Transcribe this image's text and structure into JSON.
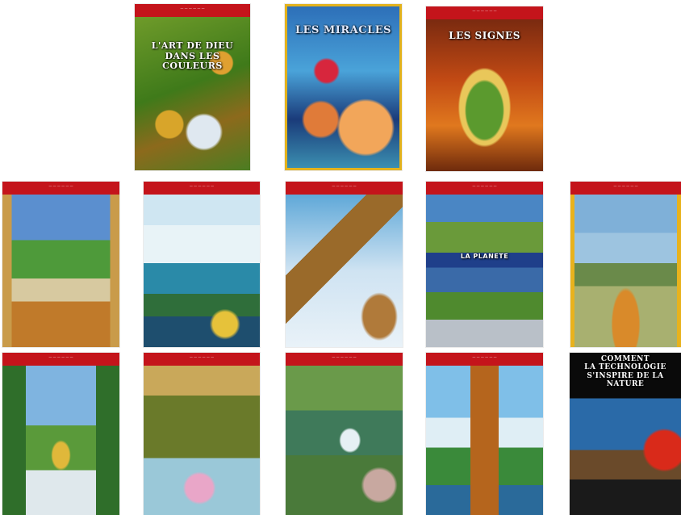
{
  "covers": [
    {
      "title": "L'ART DE DIEU\nDANS LES COULEURS"
    },
    {
      "title": "LES MIRACLES"
    },
    {
      "title": "LES SIGNES"
    },
    {
      "title": ""
    },
    {
      "title": ""
    },
    {
      "title": ""
    },
    {
      "title": "LA PLANETE"
    },
    {
      "title": ""
    },
    {
      "title": ""
    },
    {
      "title": ""
    },
    {
      "title": ""
    },
    {
      "title": ""
    },
    {
      "title": "COMMENT\nLA TECHNOLOGIE\nS'INSPIRE DE LA\nNATURE"
    }
  ]
}
